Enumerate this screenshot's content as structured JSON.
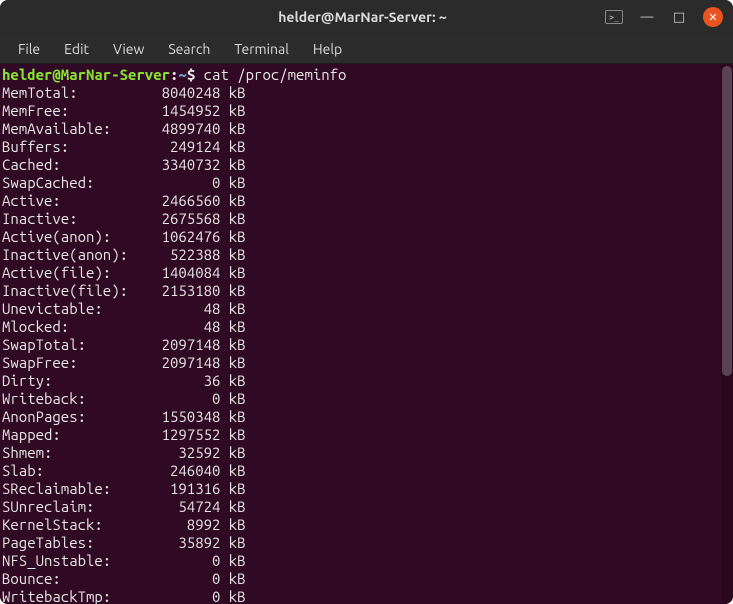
{
  "window": {
    "title": "helder@MarNar-Server: ~"
  },
  "menubar": {
    "items": [
      "File",
      "Edit",
      "View",
      "Search",
      "Terminal",
      "Help"
    ]
  },
  "prompt": {
    "user_host": "helder@MarNar-Server",
    "separator": ":",
    "path": "~",
    "symbol": "$",
    "command": "cat /proc/meminfo"
  },
  "meminfo": [
    {
      "key": "MemTotal:",
      "value": "8040248",
      "unit": "kB"
    },
    {
      "key": "MemFree:",
      "value": "1454952",
      "unit": "kB"
    },
    {
      "key": "MemAvailable:",
      "value": "4899740",
      "unit": "kB"
    },
    {
      "key": "Buffers:",
      "value": "249124",
      "unit": "kB"
    },
    {
      "key": "Cached:",
      "value": "3340732",
      "unit": "kB"
    },
    {
      "key": "SwapCached:",
      "value": "0",
      "unit": "kB"
    },
    {
      "key": "Active:",
      "value": "2466560",
      "unit": "kB"
    },
    {
      "key": "Inactive:",
      "value": "2675568",
      "unit": "kB"
    },
    {
      "key": "Active(anon):",
      "value": "1062476",
      "unit": "kB"
    },
    {
      "key": "Inactive(anon):",
      "value": "522388",
      "unit": "kB"
    },
    {
      "key": "Active(file):",
      "value": "1404084",
      "unit": "kB"
    },
    {
      "key": "Inactive(file):",
      "value": "2153180",
      "unit": "kB"
    },
    {
      "key": "Unevictable:",
      "value": "48",
      "unit": "kB"
    },
    {
      "key": "Mlocked:",
      "value": "48",
      "unit": "kB"
    },
    {
      "key": "SwapTotal:",
      "value": "2097148",
      "unit": "kB"
    },
    {
      "key": "SwapFree:",
      "value": "2097148",
      "unit": "kB"
    },
    {
      "key": "Dirty:",
      "value": "36",
      "unit": "kB"
    },
    {
      "key": "Writeback:",
      "value": "0",
      "unit": "kB"
    },
    {
      "key": "AnonPages:",
      "value": "1550348",
      "unit": "kB"
    },
    {
      "key": "Mapped:",
      "value": "1297552",
      "unit": "kB"
    },
    {
      "key": "Shmem:",
      "value": "32592",
      "unit": "kB"
    },
    {
      "key": "Slab:",
      "value": "246040",
      "unit": "kB"
    },
    {
      "key": "SReclaimable:",
      "value": "191316",
      "unit": "kB"
    },
    {
      "key": "SUnreclaim:",
      "value": "54724",
      "unit": "kB"
    },
    {
      "key": "KernelStack:",
      "value": "8992",
      "unit": "kB"
    },
    {
      "key": "PageTables:",
      "value": "35892",
      "unit": "kB"
    },
    {
      "key": "NFS_Unstable:",
      "value": "0",
      "unit": "kB"
    },
    {
      "key": "Bounce:",
      "value": "0",
      "unit": "kB"
    },
    {
      "key": "WritebackTmp:",
      "value": "0",
      "unit": "kB"
    }
  ],
  "icons": {
    "terminal_glyph": ">_",
    "minimize": "—",
    "maximize": "□",
    "close": "✕"
  }
}
